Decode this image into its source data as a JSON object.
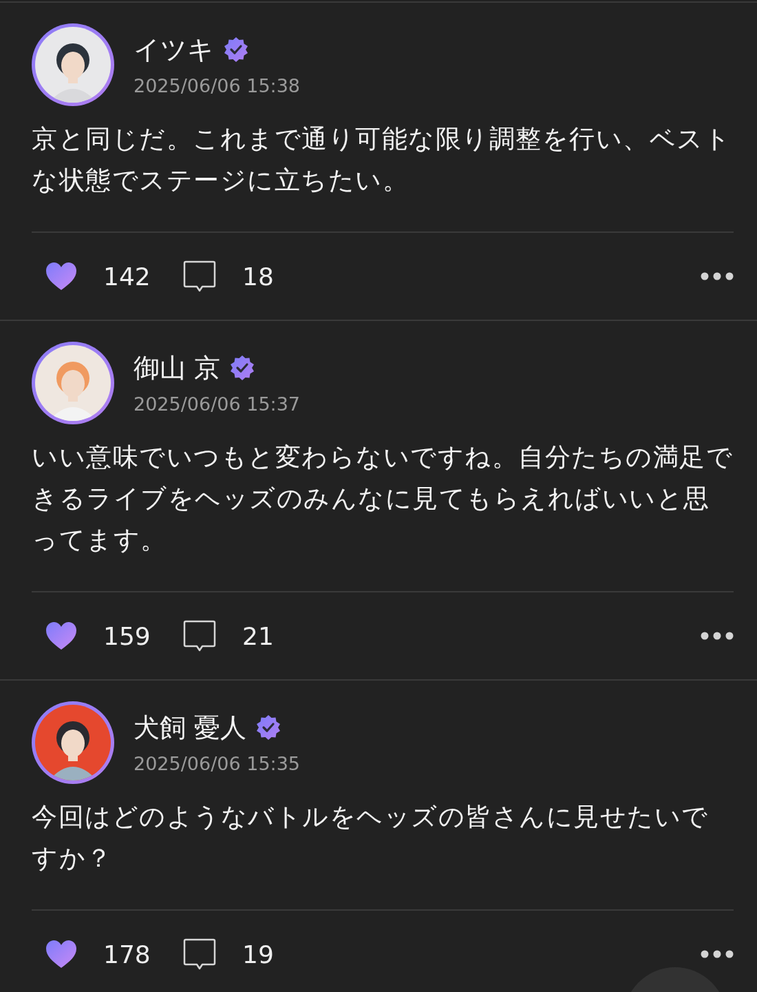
{
  "posts": [
    {
      "author": "イツキ",
      "verified": true,
      "time": "2025/06/06 15:38",
      "text": "京と同じだ。これまで通り可能な限り調整を行い、ベストな状態でステージに立ちたい。",
      "liked": true,
      "likes": "142",
      "comments": "18"
    },
    {
      "author": "御山 京",
      "verified": true,
      "time": "2025/06/06 15:37",
      "text": "いい意味でいつもと変わらないですね。自分たちの満足できるライブをヘッズのみんなに見てもらえればいいと思ってます。",
      "liked": true,
      "likes": "159",
      "comments": "21"
    },
    {
      "author": "犬飼 憂人",
      "verified": true,
      "time": "2025/06/06 15:35",
      "text": "今回はどのようなバトルをヘッズの皆さんに見せたいですか？",
      "liked": true,
      "likes": "178",
      "comments": "19"
    }
  ]
}
